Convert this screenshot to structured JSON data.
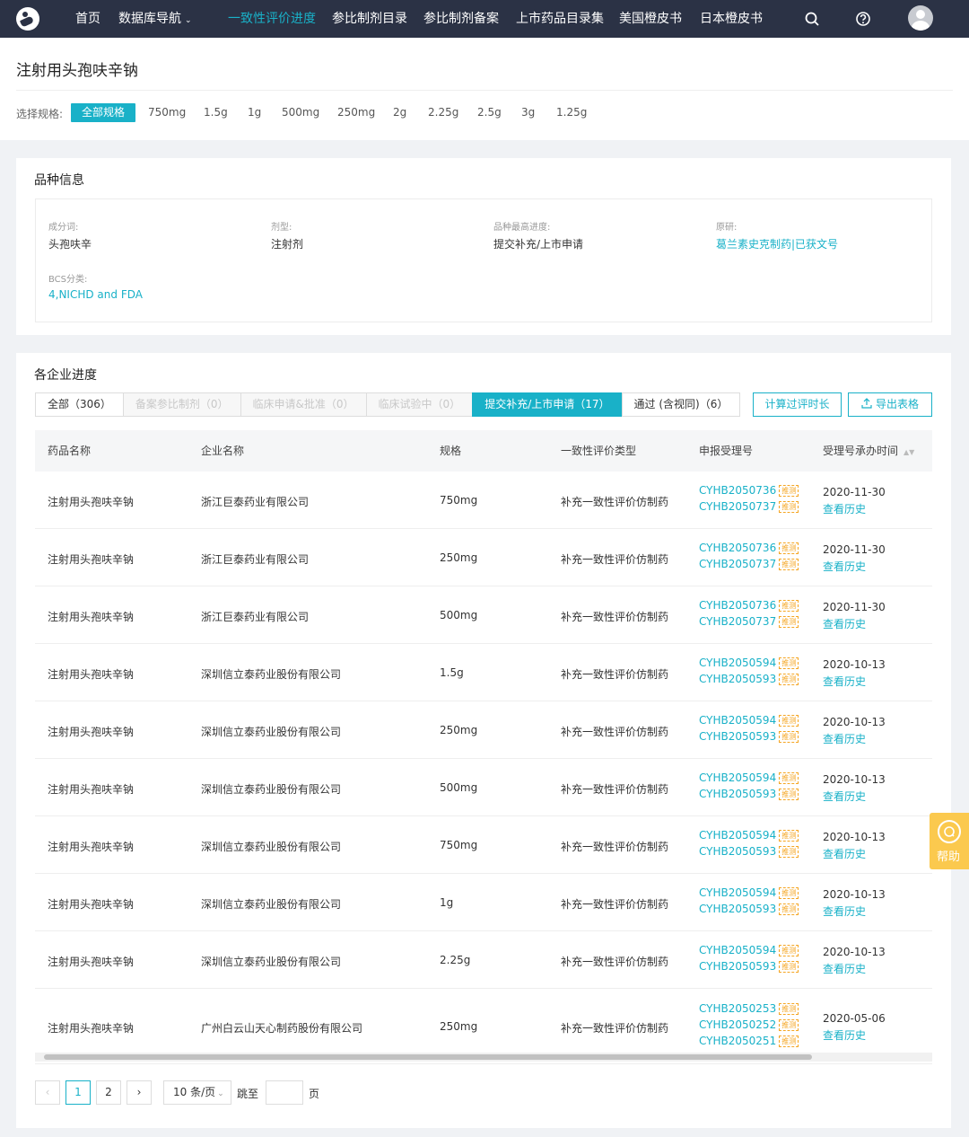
{
  "nav": {
    "items": [
      "首页",
      "数据库导航",
      "一致性评价进度",
      "参比制剂目录",
      "参比制剂备案",
      "上市药品目录集",
      "美国橙皮书",
      "日本橙皮书"
    ],
    "active": "一致性评价进度",
    "icons": [
      "logo-icon",
      "search-icon",
      "help-circle-icon",
      "avatar"
    ]
  },
  "header": {
    "title": "注射用头孢呋辛钠",
    "spec_label": "选择规格:",
    "specs": [
      "全部规格",
      "750mg",
      "1.5g",
      "1g",
      "500mg",
      "250mg",
      "2g",
      "2.25g",
      "2.5g",
      "3g",
      "1.25g"
    ],
    "active_spec": "全部规格"
  },
  "info": {
    "title": "品种信息",
    "fields": [
      {
        "label": "成分词:",
        "value": "头孢呋辛"
      },
      {
        "label": "剂型:",
        "value": "注射剂"
      },
      {
        "label": "品种最高进度:",
        "value": "提交补充/上市申请"
      },
      {
        "label": "原研:",
        "value": "葛兰素史克制药|已获文号"
      },
      {
        "label": "BCS分类:",
        "value": "4,NICHD and FDA"
      }
    ]
  },
  "progress": {
    "title": "各企业进度",
    "tabs": [
      {
        "label": "全部（306）",
        "state": "normal"
      },
      {
        "label": "备案参比制剂（0）",
        "state": "disabled"
      },
      {
        "label": "临床申请&批准（0）",
        "state": "disabled"
      },
      {
        "label": "临床试验中（0）",
        "state": "disabled"
      },
      {
        "label": "提交补充/上市申请（17）",
        "state": "active"
      },
      {
        "label": "通过 (含视同)（6）",
        "state": "normal"
      }
    ],
    "btn_calc": "计算过评时长",
    "btn_export": "导出表格",
    "columns": [
      "药品名称",
      "企业名称",
      "规格",
      "一致性评价类型",
      "申报受理号",
      "受理号承办时间"
    ],
    "tag_label": "推测",
    "history_label": "查看历史",
    "rows": [
      {
        "drug": "注射用头孢呋辛钠",
        "company": "浙江巨泰药业有限公司",
        "spec": "750mg",
        "type": "补充一致性评价仿制药",
        "codes": [
          "CYHB2050736",
          "CYHB2050737"
        ],
        "date": "2020-11-30"
      },
      {
        "drug": "注射用头孢呋辛钠",
        "company": "浙江巨泰药业有限公司",
        "spec": "250mg",
        "type": "补充一致性评价仿制药",
        "codes": [
          "CYHB2050736",
          "CYHB2050737"
        ],
        "date": "2020-11-30"
      },
      {
        "drug": "注射用头孢呋辛钠",
        "company": "浙江巨泰药业有限公司",
        "spec": "500mg",
        "type": "补充一致性评价仿制药",
        "codes": [
          "CYHB2050736",
          "CYHB2050737"
        ],
        "date": "2020-11-30"
      },
      {
        "drug": "注射用头孢呋辛钠",
        "company": "深圳信立泰药业股份有限公司",
        "spec": "1.5g",
        "type": "补充一致性评价仿制药",
        "codes": [
          "CYHB2050594",
          "CYHB2050593"
        ],
        "date": "2020-10-13"
      },
      {
        "drug": "注射用头孢呋辛钠",
        "company": "深圳信立泰药业股份有限公司",
        "spec": "250mg",
        "type": "补充一致性评价仿制药",
        "codes": [
          "CYHB2050594",
          "CYHB2050593"
        ],
        "date": "2020-10-13"
      },
      {
        "drug": "注射用头孢呋辛钠",
        "company": "深圳信立泰药业股份有限公司",
        "spec": "500mg",
        "type": "补充一致性评价仿制药",
        "codes": [
          "CYHB2050594",
          "CYHB2050593"
        ],
        "date": "2020-10-13"
      },
      {
        "drug": "注射用头孢呋辛钠",
        "company": "深圳信立泰药业股份有限公司",
        "spec": "750mg",
        "type": "补充一致性评价仿制药",
        "codes": [
          "CYHB2050594",
          "CYHB2050593"
        ],
        "date": "2020-10-13"
      },
      {
        "drug": "注射用头孢呋辛钠",
        "company": "深圳信立泰药业股份有限公司",
        "spec": "1g",
        "type": "补充一致性评价仿制药",
        "codes": [
          "CYHB2050594",
          "CYHB2050593"
        ],
        "date": "2020-10-13"
      },
      {
        "drug": "注射用头孢呋辛钠",
        "company": "深圳信立泰药业股份有限公司",
        "spec": "2.25g",
        "type": "补充一致性评价仿制药",
        "codes": [
          "CYHB2050594",
          "CYHB2050593"
        ],
        "date": "2020-10-13"
      },
      {
        "drug": "注射用头孢呋辛钠",
        "company": "广州白云山天心制药股份有限公司",
        "spec": "250mg",
        "type": "补充一致性评价仿制药",
        "codes": [
          "CYHB2050253",
          "CYHB2050252",
          "CYHB2050251"
        ],
        "date": "2020-05-06"
      }
    ]
  },
  "pager": {
    "pages": [
      "1",
      "2"
    ],
    "current": "1",
    "page_size": "10 条/页",
    "jump_label": "跳至",
    "page_unit": "页"
  },
  "help": {
    "label": "帮助"
  },
  "colors": {
    "accent": "#19b1c8",
    "nav_bg": "#2b3245",
    "tag": "#f5a623",
    "help_bg": "#fbc94e"
  }
}
